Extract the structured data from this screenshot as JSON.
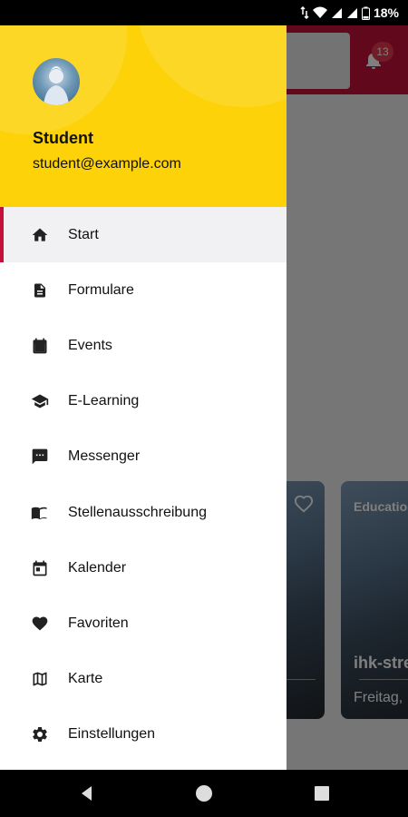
{
  "status_bar": {
    "battery": "18%"
  },
  "background": {
    "notification_count": "13",
    "cards": [
      {
        "tag": "",
        "title": "",
        "subtitle": ""
      },
      {
        "tag": "Education",
        "title": "ihk-stre",
        "subtitle": "Freitag,"
      }
    ]
  },
  "drawer": {
    "user": {
      "name": "Student",
      "email": "student@example.com"
    },
    "items": [
      {
        "label": "Start",
        "icon": "home-icon",
        "active": true
      },
      {
        "label": "Formulare",
        "icon": "document-icon"
      },
      {
        "label": "Events",
        "icon": "calendar-event-icon"
      },
      {
        "label": "E-Learning",
        "icon": "graduation-cap-icon"
      },
      {
        "label": "Messenger",
        "icon": "chat-bubble-icon"
      },
      {
        "label": "Stellenausschreibung",
        "icon": "open-book-icon"
      },
      {
        "label": "Kalender",
        "icon": "calendar-icon"
      },
      {
        "label": "Favoriten",
        "icon": "heart-icon"
      },
      {
        "label": "Karte",
        "icon": "map-icon"
      },
      {
        "label": "Einstellungen",
        "icon": "gear-icon"
      }
    ]
  },
  "colors": {
    "accent": "#c4103a",
    "header_yellow": "#fdd209",
    "active_bg": "#f1f1f3"
  }
}
